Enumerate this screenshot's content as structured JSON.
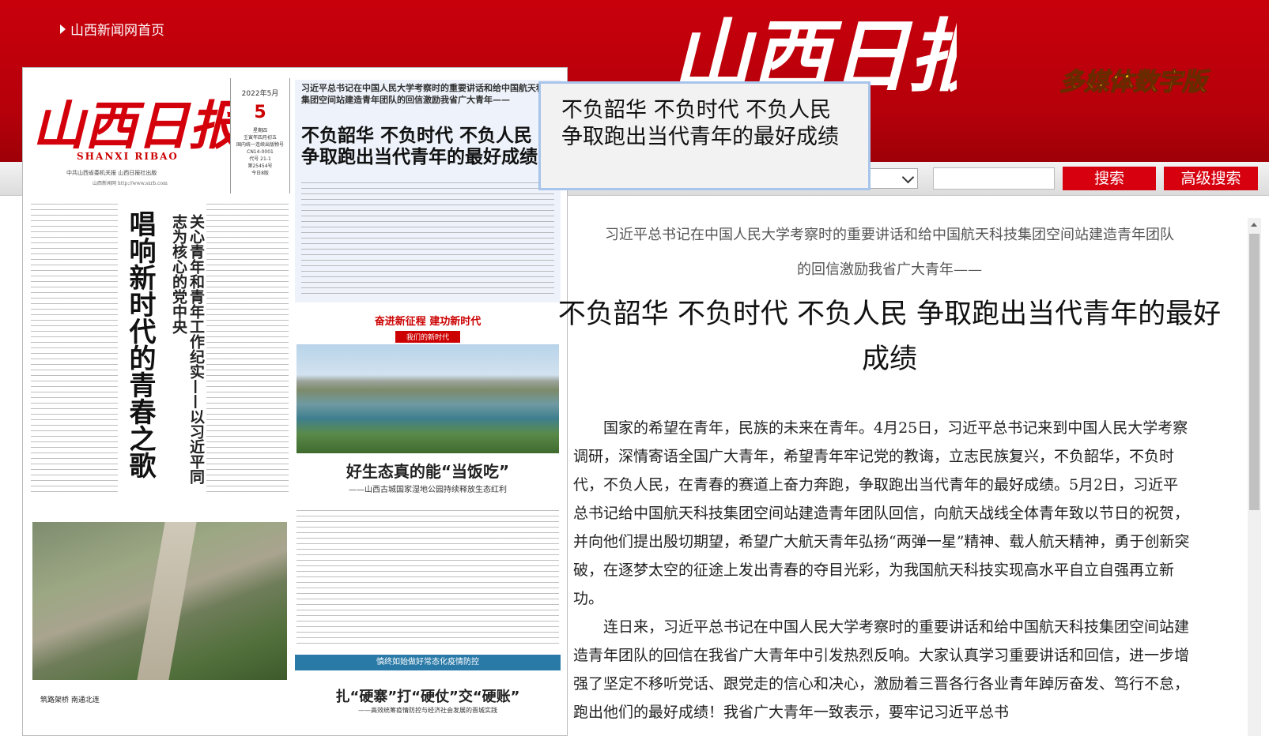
{
  "header": {
    "home_link": "山西新闻网首页",
    "logo_text": "山西日报",
    "edition_label": "多媒体数字版"
  },
  "toolbar": {
    "search_button": "搜索",
    "advanced_search_button": "高级搜索",
    "search_input_value": ""
  },
  "newspaper_page": {
    "masthead": "山西日报",
    "pinyin": "SHANXI RIBAO",
    "sub_info": "中共山西省委机关报  山西日报社出版",
    "url": "山西新闻网 http://www.sxrb.com",
    "date_ym": "2022年5月",
    "date_day": "5",
    "date_info": [
      "星期四",
      "壬寅年四月初五",
      "国内统一连续出版物号",
      "CN14-0001",
      "代号 21-1",
      "第25454号",
      "今日8版"
    ],
    "lead_kicker": "习近平总书记在中国人民大学考察时的重要讲话和给中国航天科技集团空间站建造青年团队的回信激励我省广大青年——",
    "lead_title": "不负韶华 不负时代 不负人民 争取跑出当代青年的最好成绩",
    "vertical_title": "唱响新时代的青春之歌",
    "vertical_subtitle": "关心青年和青年工作纪实——以习近平同志为核心的党中央",
    "feature_banner": "奋进新征程 建功新时代",
    "feature_subbanner": "我们的新时代",
    "feature_title": "好生态真的能“当饭吃”",
    "feature_subtitle": "——山西古城国家湿地公园持续释放生态红利",
    "photo_caption": "筑路架桥  南通北连",
    "blue_banner": "慎终如始做好常态化疫情防控",
    "bottom_title": "扎“硬寨”打“硬仗”交“硬账”",
    "bottom_subtitle": "——高效统筹疫情防控与经济社会发展的晋城实践"
  },
  "tooltip": {
    "text": "不负韶华 不负时代 不负人民 争取跑出当代青年的最好成绩"
  },
  "article": {
    "kicker_line1": "习近平总书记在中国人民大学考察时的重要讲话和给中国航天科技集团空间站建造青年团队",
    "kicker_line2": "的回信激励我省广大青年——",
    "title": "不负韶华 不负时代 不负人民 争取跑出当代青年的最好成绩",
    "paragraphs": [
      "国家的希望在青年，民族的未来在青年。4月25日，习近平总书记来到中国人民大学考察调研，深情寄语全国广大青年，希望青年牢记党的教诲，立志民族复兴，不负韶华，不负时代，不负人民，在青春的赛道上奋力奔跑，争取跑出当代青年的最好成绩。5月2日，习近平总书记给中国航天科技集团空间站建造青年团队回信，向航天战线全体青年致以节日的祝贺，并向他们提出殷切期望，希望广大航天青年弘扬“两弹一星”精神、载人航天精神，勇于创新突破，在逐梦太空的征途上发出青春的夺目光彩，为我国航天科技实现高水平自立自强再立新功。",
      "连日来，习近平总书记在中国人民大学考察时的重要讲话和给中国航天科技集团空间站建造青年团队的回信在我省广大青年中引发热烈反响。大家认真学习重要讲话和回信，进一步增强了坚定不移听党话、跟党走的信心和决心，激励着三晋各行各业青年踔厉奋发、笃行不怠，跑出他们的最好成绩！我省广大青年一致表示，要牢记习近平总书"
    ]
  },
  "colors": {
    "banner_red": "#c8000c",
    "button_red": "#d6000f",
    "tooltip_border": "#a7c4ea"
  }
}
